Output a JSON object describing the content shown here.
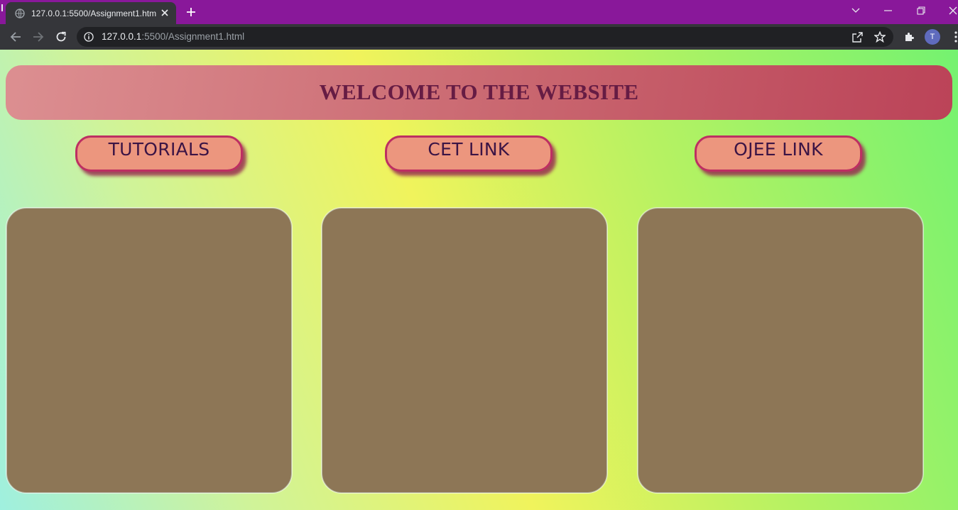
{
  "browser": {
    "tab_title": "127.0.0.1:5500/Assignment1.html",
    "url_host": "127.0.0.1",
    "url_rest": ":5500/Assignment1.html",
    "profile_initial": "T",
    "accent_color": "#89189a"
  },
  "page": {
    "header_title": "WELCOME TO THE WEBSITE",
    "buttons": [
      {
        "label": "TUTORIALS"
      },
      {
        "label": "CET LINK"
      },
      {
        "label": "OJEE LINK"
      }
    ],
    "colors": {
      "header_text": "#661c44",
      "button_fill": "#ec967e",
      "button_border": "#bd2f62",
      "card_fill": "#8d7656"
    }
  }
}
